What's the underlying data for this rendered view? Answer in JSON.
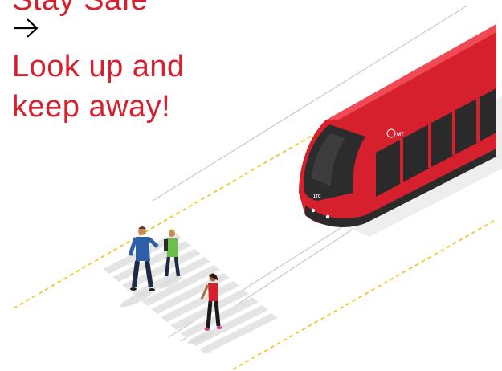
{
  "headline": {
    "top_text": "Stay Safe",
    "line2": "Look up and",
    "line3": "keep away!"
  },
  "icons": {
    "arrow": "arrow-right-icon"
  },
  "tram_branding": {
    "logo_text": "MT",
    "front_badge": "1TC"
  },
  "colors": {
    "accent_red": "#d81f2d",
    "tram_red": "#d6202e",
    "lane_yellow": "#f3c219",
    "track_grey": "#c8c8c8",
    "crossing_grey": "#e3e3e3"
  }
}
